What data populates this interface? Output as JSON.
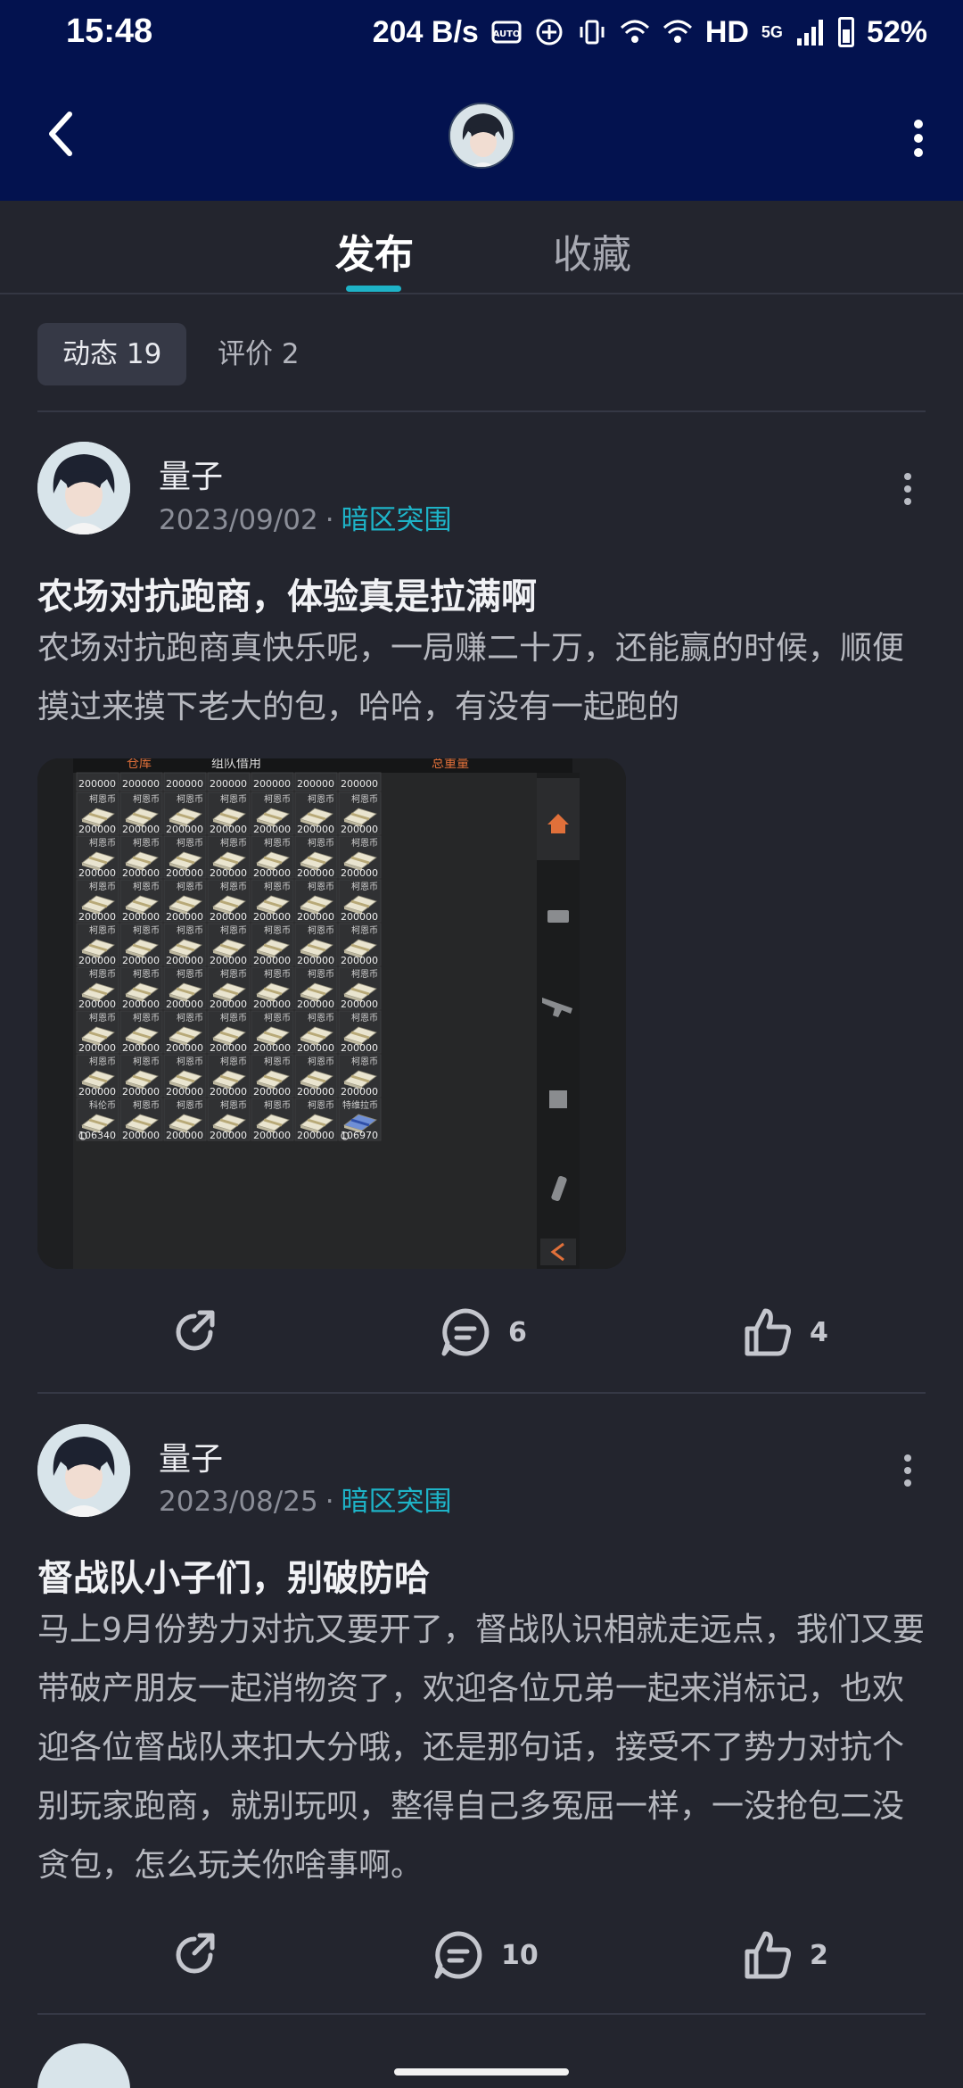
{
  "status_bar": {
    "time": "15:48",
    "network_speed": "204 B/s",
    "hd": "HD",
    "net_type": "5G",
    "battery": "52%"
  },
  "tabs": [
    {
      "label": "发布",
      "active": true
    },
    {
      "label": "收藏",
      "active": false
    }
  ],
  "filters": [
    {
      "label": "动态 19",
      "active": true
    },
    {
      "label": "评价 2",
      "active": false
    }
  ],
  "posts": [
    {
      "author": "量子",
      "date": "2023/09/02",
      "tag": "暗区突围",
      "title": "农场对抗跑商，体验真是拉满啊",
      "body": "农场对抗跑商真快乐呢，一局赚二十万，还能赢的时候，顺便摸过来摸下老大的包，哈哈，有没有一起跑的",
      "image": {
        "header_left": "仓库",
        "header_mid": "组队借用",
        "header_right": "总重量",
        "cell_label": "柯恩币",
        "cell_value": "200000",
        "first_cell_label": "科伦币",
        "first_cell_value": "106340",
        "last_cell_label": "特维拉币",
        "last_cell_value": "106970"
      },
      "comments": "6",
      "likes": "4"
    },
    {
      "author": "量子",
      "date": "2023/08/25",
      "tag": "暗区突围",
      "title": "督战队小子们，别破防哈",
      "body": "马上9月份势力对抗又要开了，督战队识相就走远点，我们又要带破产朋友一起消物资了，欢迎各位兄弟一起来消标记，也欢迎各位督战队来扣大分哦，还是那句话，接受不了势力对抗个别玩家跑商，就别玩呗，整得自己多冤屈一样，一没抢包二没贪包，怎么玩关你啥事啊。",
      "comments": "10",
      "likes": "2"
    }
  ],
  "colors": {
    "header_bg": "#03124f",
    "page_bg": "#23252e",
    "accent": "#1eb3c7"
  }
}
